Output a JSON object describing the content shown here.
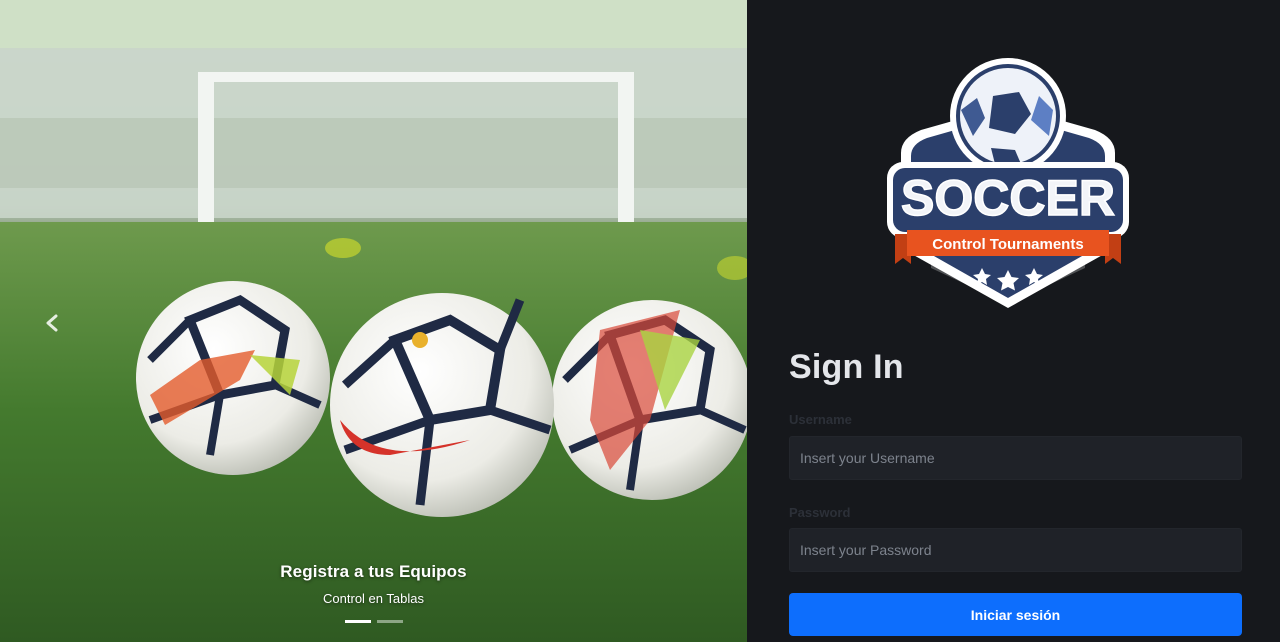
{
  "carousel": {
    "caption_title": "Registra a tus Equipos",
    "caption_text": "Control en Tablas",
    "slide_count": 2,
    "active_slide": 1
  },
  "logo": {
    "wordmark": "SOCCER",
    "ribbon_text": "Control Tournaments"
  },
  "login": {
    "title": "Sign In",
    "username_label": "Username",
    "username_placeholder": "Insert your Username",
    "password_label": "Password",
    "password_placeholder": "Insert your Password",
    "submit_label": "Iniciar sesión"
  },
  "colors": {
    "panel_bg": "#16181c",
    "button": "#0d6efd",
    "logo_navy": "#2b3f6b",
    "logo_orange": "#e8531f"
  }
}
